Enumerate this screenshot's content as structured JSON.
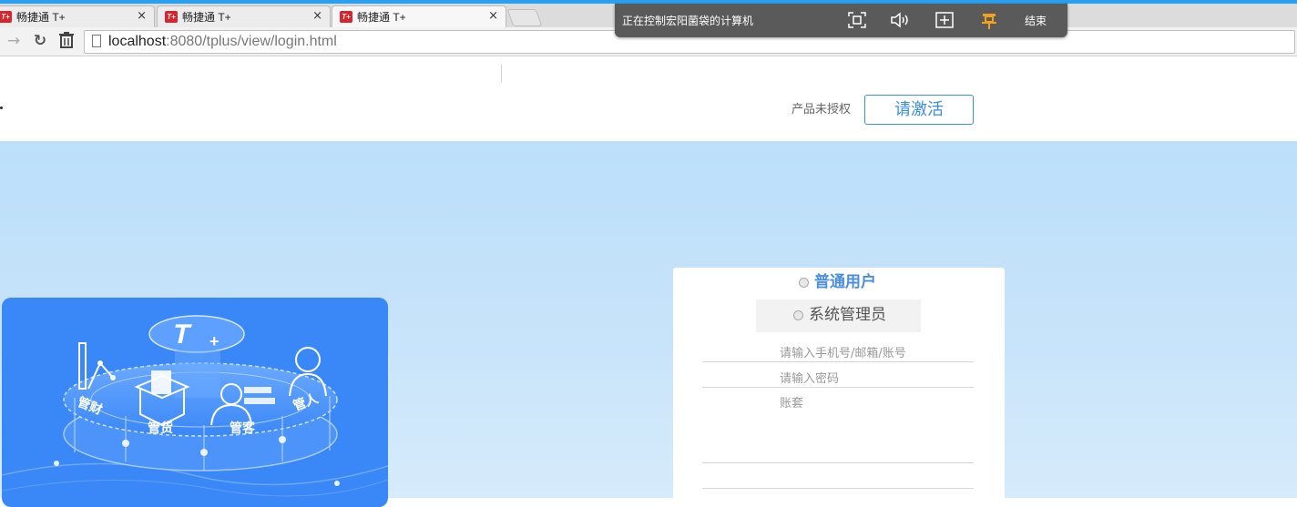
{
  "browser": {
    "tabs": [
      {
        "title": "畅捷通 T+",
        "close": "×"
      },
      {
        "title": "畅捷通 T+",
        "close": "×"
      },
      {
        "title": "畅捷通 T+",
        "close": "×"
      }
    ],
    "url_host": "localhost",
    "url_rest": ":8080/tplus/view/login.html"
  },
  "remote_bar": {
    "status": "正在控制宏阳菌袋的计算机",
    "end_label": "结束"
  },
  "header": {
    "license_text": "产品未授权",
    "activate_label": "请激活"
  },
  "promo": {
    "logo_text": "T",
    "labels": [
      "管财",
      "管货",
      "管客",
      "管人"
    ]
  },
  "login": {
    "role_user": "普通用户",
    "role_admin": "系统管理员",
    "account_placeholder": "请输入手机号/邮箱/账号",
    "password_placeholder": "请输入密码",
    "book_placeholder": "账套"
  },
  "colors": {
    "accent": "#3a8ee6",
    "promo_blue": "#3a87f7",
    "brand_red": "#d9232d"
  }
}
